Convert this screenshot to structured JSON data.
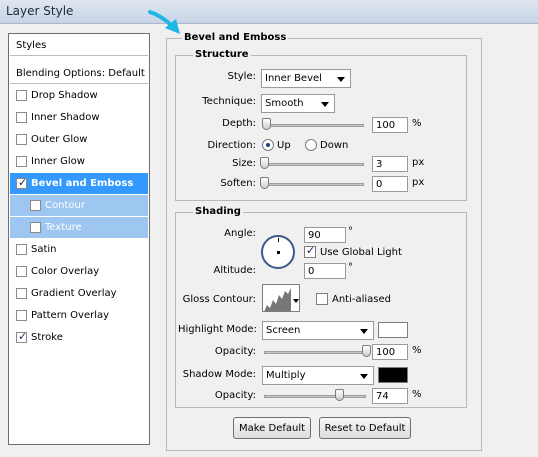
{
  "window": {
    "title": "Layer Style"
  },
  "left_panel": {
    "items": [
      {
        "label": "Styles"
      },
      {
        "label": "Blending Options: Default"
      },
      {
        "label": "Drop Shadow",
        "checked": false
      },
      {
        "label": "Inner Shadow",
        "checked": false
      },
      {
        "label": "Outer Glow",
        "checked": false
      },
      {
        "label": "Inner Glow",
        "checked": false
      },
      {
        "label": "Bevel and Emboss",
        "checked": true
      },
      {
        "label": "Contour",
        "checked": false
      },
      {
        "label": "Texture",
        "checked": false
      },
      {
        "label": "Satin",
        "checked": false
      },
      {
        "label": "Color Overlay",
        "checked": false
      },
      {
        "label": "Gradient Overlay",
        "checked": false
      },
      {
        "label": "Pattern Overlay",
        "checked": false
      },
      {
        "label": "Stroke",
        "checked": true
      }
    ]
  },
  "panel": {
    "title": "Bevel and Emboss"
  },
  "structure": {
    "title": "Structure",
    "style_label": "Style:",
    "style_value": "Inner Bevel",
    "technique_label": "Technique:",
    "technique_value": "Smooth",
    "depth_label": "Depth:",
    "depth_value": "100",
    "depth_unit": "%",
    "depth_fraction": 0.02,
    "direction_label": "Direction:",
    "direction_up": "Up",
    "direction_down": "Down",
    "direction_selected": "Up",
    "size_label": "Size:",
    "size_value": "3",
    "size_unit": "px",
    "size_fraction": 0.0,
    "soften_label": "Soften:",
    "soften_value": "0",
    "soften_unit": "px",
    "soften_fraction": 0.0
  },
  "shading": {
    "title": "Shading",
    "angle_label": "Angle:",
    "angle_value": "90",
    "angle_unit": "°",
    "use_global_light_label": "Use Global Light",
    "use_global_light": true,
    "altitude_label": "Altitude:",
    "altitude_value": "0",
    "altitude_unit": "°",
    "gloss_contour_label": "Gloss Contour:",
    "anti_aliased_label": "Anti-aliased",
    "anti_aliased": false,
    "highlight_mode_label": "Highlight Mode:",
    "highlight_mode_value": "Screen",
    "highlight_color": "#ffffff",
    "highlight_opacity_label": "Opacity:",
    "highlight_opacity_value": "100",
    "highlight_opacity_unit": "%",
    "highlight_opacity_fraction": 1.0,
    "shadow_mode_label": "Shadow Mode:",
    "shadow_mode_value": "Multiply",
    "shadow_color": "#000000",
    "shadow_opacity_label": "Opacity:",
    "shadow_opacity_value": "74",
    "shadow_opacity_unit": "%",
    "shadow_opacity_fraction": 0.74
  },
  "buttons": {
    "make_default": "Make Default",
    "reset_to_default": "Reset to Default"
  },
  "colors": {
    "selection": "#3399ff",
    "sub_selection": "#9dc6f0",
    "accent_arrow": "#1fb6e6"
  }
}
